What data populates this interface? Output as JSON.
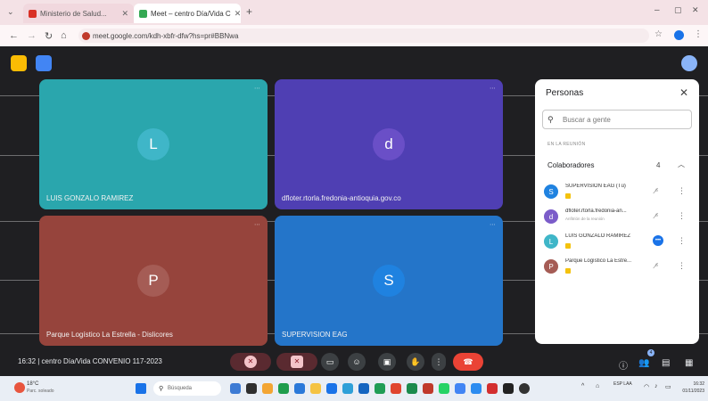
{
  "browser": {
    "tabs": [
      {
        "title": "Ministerio de Salud...",
        "favicon_color": "#d93025",
        "active": false
      },
      {
        "title": "Meet – centro Día/Vida C",
        "favicon_color": "#34a853",
        "active": true
      }
    ],
    "new_tab": "+",
    "url": "meet.google.com/kdh-xbfr-dfw?hs=pr#BBNwa",
    "minimize": "–",
    "maximize": "▢",
    "close": "✕"
  },
  "meet": {
    "tiles": [
      {
        "name": "LUIS GONZALO RAMIREZ",
        "initial": "L",
        "bg": "#2aa6ad",
        "avatar_bg": "#3fb6c8"
      },
      {
        "name": "dfloter.rtorla.fredonia-antioquia.gov.co",
        "initial": "d",
        "bg": "#4f3fb3",
        "avatar_bg": "#6a4fc7"
      },
      {
        "name": "Parque Logístico La Estrella - Dislicores",
        "initial": "P",
        "bg": "#96443c",
        "avatar_bg": "#a55c55"
      },
      {
        "name": "SUPERVISION EAG",
        "initial": "S",
        "bg": "#2475c9",
        "avatar_bg": "#1f82e0"
      }
    ],
    "meeting_info": "16:32 | centro Día/Vida CONVENIO 117-2023"
  },
  "people_panel": {
    "title": "Personas",
    "close": "✕",
    "search_placeholder": "Buscar a gente",
    "section_label": "EN LA REUNIÓN",
    "group_label": "Colaboradores",
    "group_count": "4",
    "people": [
      {
        "name": "SUPERVISION EAG (Tú)",
        "initial": "S",
        "color": "#1f82e0",
        "sub": ""
      },
      {
        "name": "dfloter.rtorla.fredonia-an...",
        "initial": "d",
        "color": "#7b5cc9",
        "sub": "Anfitrión de la reunión"
      },
      {
        "name": "LUIS GONZALO RAMIREZ",
        "initial": "L",
        "color": "#3fb6c8",
        "sub": ""
      },
      {
        "name": "Parque Logístico La Estre...",
        "initial": "P",
        "color": "#a55c55",
        "sub": ""
      }
    ]
  },
  "taskbar": {
    "weather_temp": "18°C",
    "weather_status": "Parc. soleado",
    "search": "Búsqueda",
    "tray": "ESP LAA",
    "clock_time": "16:32",
    "clock_date": "01/11/2023",
    "colors": {
      "red": "#d93025",
      "blue": "#1a73e8",
      "green": "#34a853",
      "yellow": "#fbbc04"
    }
  }
}
